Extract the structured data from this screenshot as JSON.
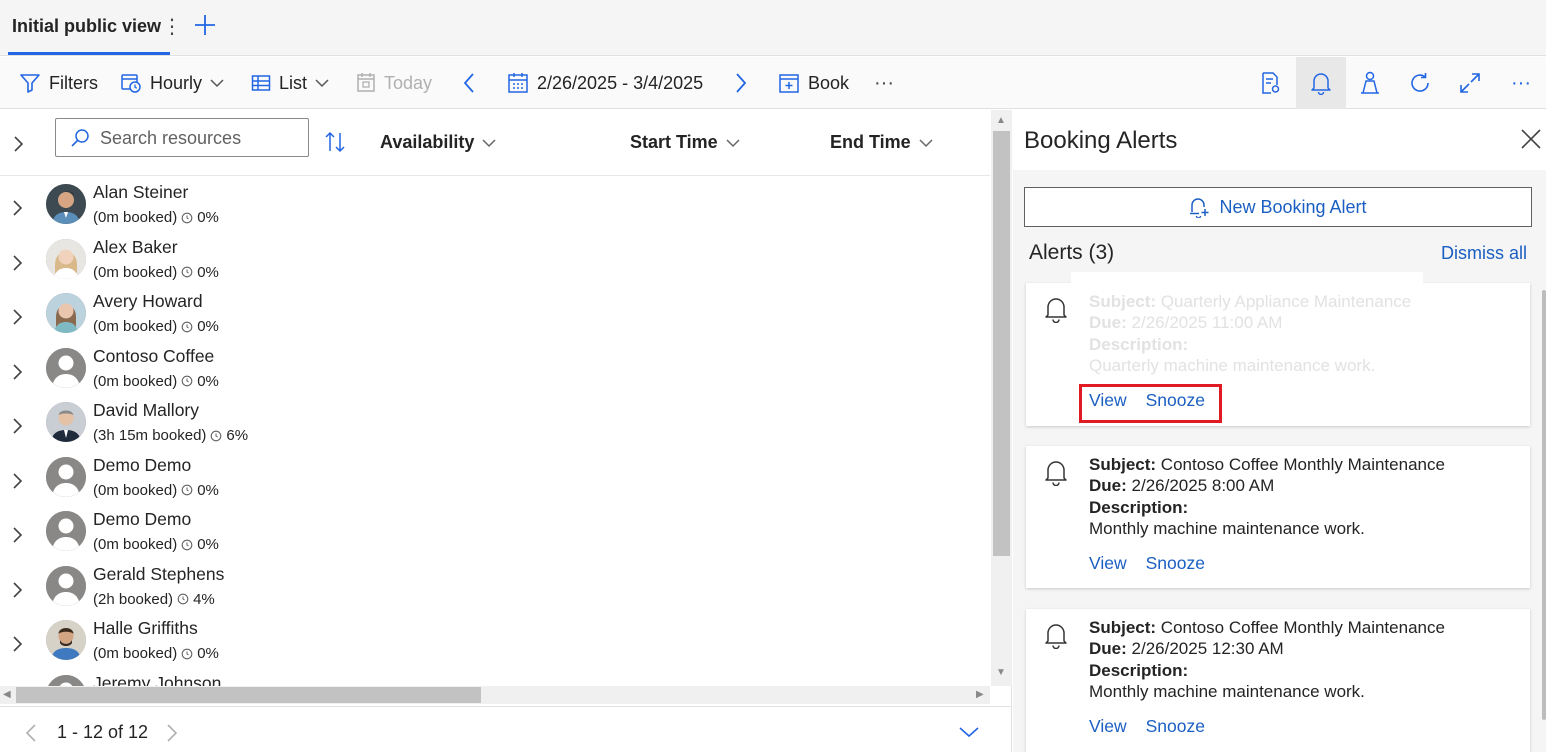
{
  "tabs": {
    "active_label": "Initial public view"
  },
  "toolbar": {
    "filters": "Filters",
    "hourly": "Hourly",
    "list": "List",
    "today": "Today",
    "date_range": "2/26/2025 - 3/4/2025",
    "book": "Book",
    "more": "···"
  },
  "grid": {
    "search_placeholder": "Search resources",
    "columns": [
      "Availability",
      "Start Time",
      "End Time"
    ],
    "rows": [
      {
        "name": "Alan Steiner",
        "booked": "(0m booked)",
        "pct": "0%"
      },
      {
        "name": "Alex Baker",
        "booked": "(0m booked)",
        "pct": "0%"
      },
      {
        "name": "Avery Howard",
        "booked": "(0m booked)",
        "pct": "0%"
      },
      {
        "name": "Contoso Coffee",
        "booked": "(0m booked)",
        "pct": "0%"
      },
      {
        "name": "David Mallory",
        "booked": "(3h 15m booked)",
        "pct": "6%"
      },
      {
        "name": "Demo Demo",
        "booked": "(0m booked)",
        "pct": "0%"
      },
      {
        "name": "Demo Demo",
        "booked": "(0m booked)",
        "pct": "0%"
      },
      {
        "name": "Gerald Stephens",
        "booked": "(2h booked)",
        "pct": "4%"
      },
      {
        "name": "Halle Griffiths",
        "booked": "(0m booked)",
        "pct": "0%"
      },
      {
        "name": "Jeremy Johnson",
        "booked": "",
        "pct": ""
      }
    ],
    "pager_text": "1 - 12 of 12"
  },
  "panel": {
    "title": "Booking Alerts",
    "new_alert": "New Booking Alert",
    "alerts_count": "Alerts (3)",
    "dismiss_all": "Dismiss all",
    "labels": {
      "subject": "Subject:",
      "due": "Due:",
      "description": "Description:"
    },
    "alerts": [
      {
        "subject": "Quarterly Appliance Maintenance",
        "due": "2/26/2025 11:00 AM",
        "description": "Quarterly machine maintenance work.",
        "view": "View",
        "snooze": "Snooze"
      },
      {
        "subject": "Contoso Coffee Monthly Maintenance",
        "due": "2/26/2025 8:00 AM",
        "description": "Monthly machine maintenance work.",
        "view": "View",
        "snooze": "Snooze"
      },
      {
        "subject": "Contoso Coffee Monthly Maintenance",
        "due": "2/26/2025 12:30 AM",
        "description": "Monthly machine maintenance work.",
        "view": "View",
        "snooze": "Snooze"
      }
    ]
  },
  "colors": {
    "accent": "#2266e3",
    "link": "#1b5fc2",
    "highlight": "#e01b24"
  }
}
